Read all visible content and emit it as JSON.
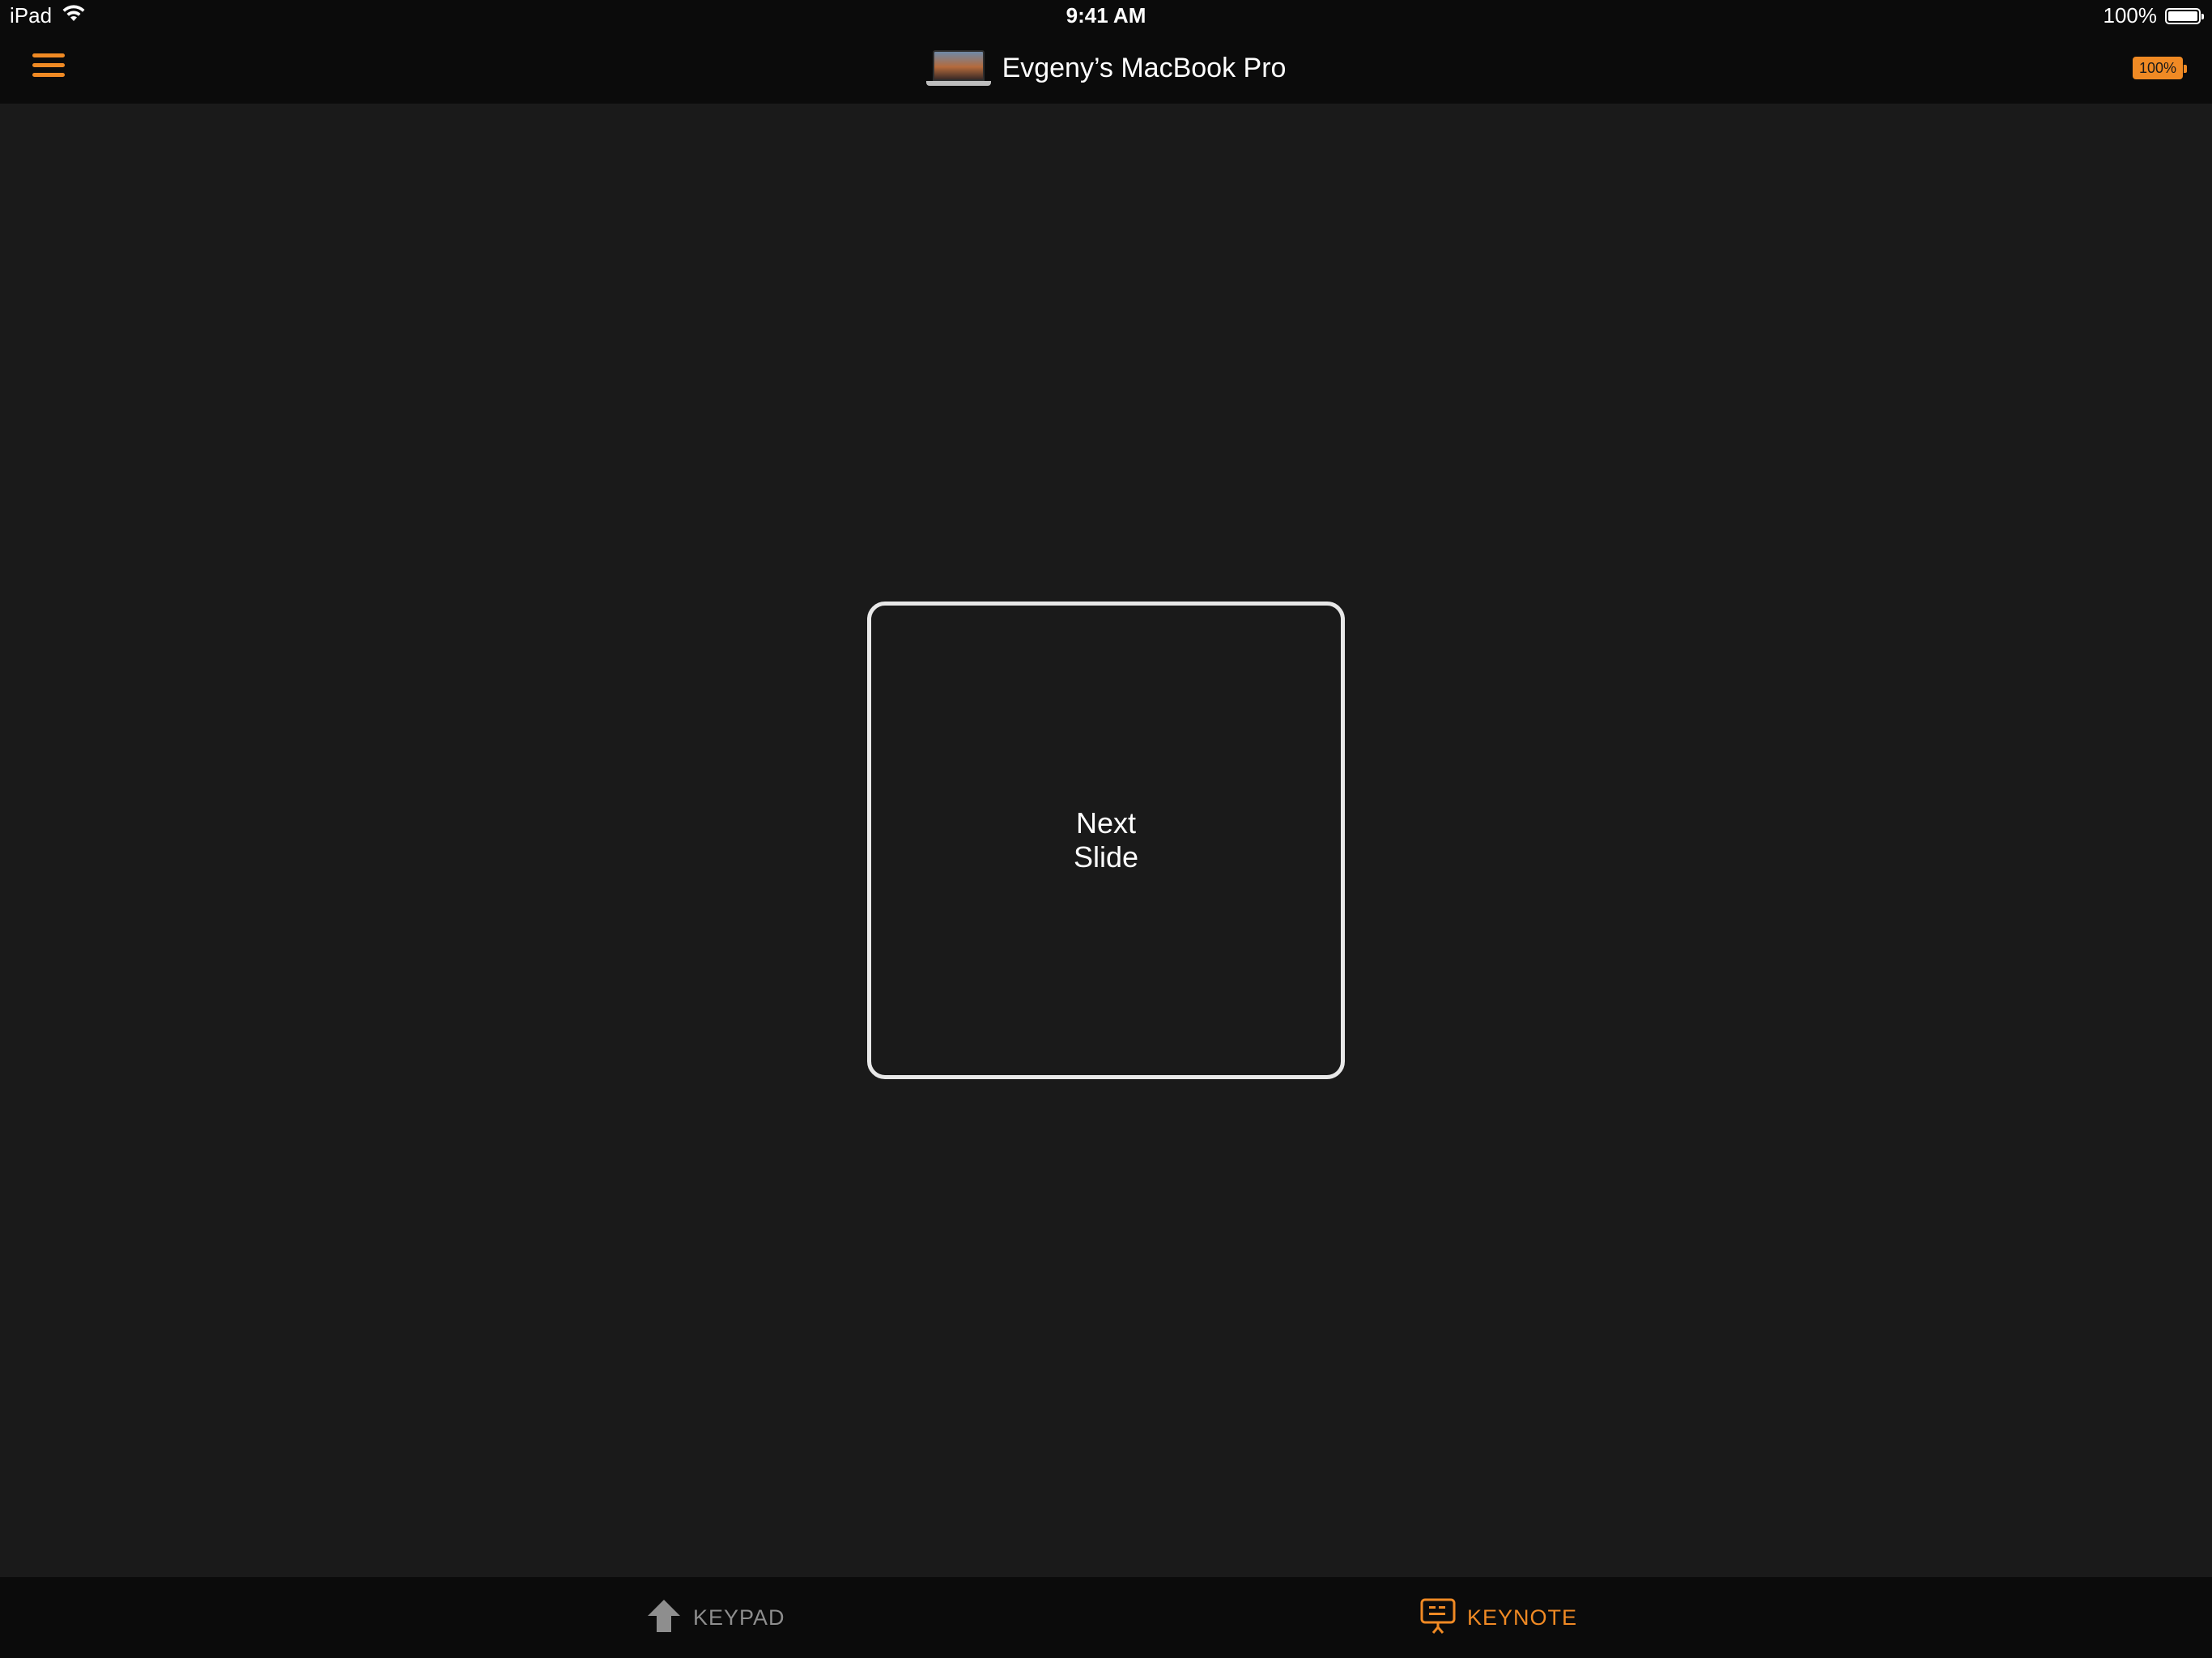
{
  "status_bar": {
    "device": "iPad",
    "time": "9:41 AM",
    "battery_percent": "100%"
  },
  "nav_bar": {
    "title": "Evgeny’s MacBook Pro",
    "battery_badge": "100%",
    "accent_color": "#f08a24"
  },
  "main": {
    "next_slide_line1": "Next",
    "next_slide_line2": "Slide"
  },
  "tab_bar": {
    "tabs": [
      {
        "label": "KEYPAD",
        "icon": "arrow-up-icon",
        "selected": false
      },
      {
        "label": "KEYNOTE",
        "icon": "presentation-icon",
        "selected": true
      }
    ]
  },
  "colors": {
    "background": "#1a1a1a",
    "bar_background": "#0b0b0b",
    "accent": "#f08a24",
    "inactive_tab": "#8e8e8e"
  }
}
